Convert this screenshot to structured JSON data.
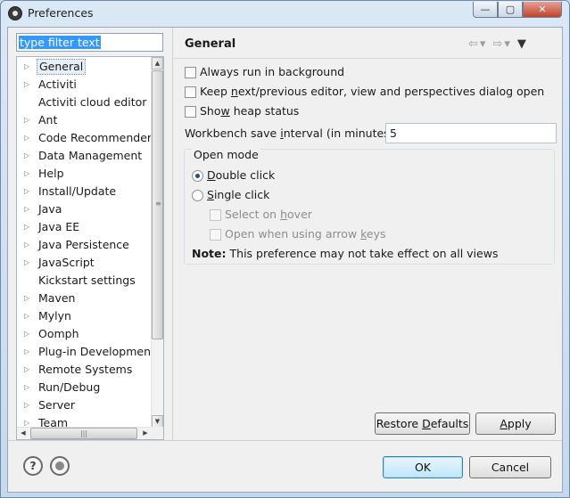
{
  "window": {
    "title": "Preferences",
    "min_glyph": "—",
    "max_glyph": "▢",
    "close_glyph": "✕"
  },
  "filter": {
    "text": "type filter text"
  },
  "tree": {
    "items": [
      {
        "label": "General",
        "expandable": true,
        "selected": true
      },
      {
        "label": "Activiti",
        "expandable": true
      },
      {
        "label": "Activiti cloud editor",
        "expandable": false
      },
      {
        "label": "Ant",
        "expandable": true
      },
      {
        "label": "Code Recommenders",
        "expandable": true
      },
      {
        "label": "Data Management",
        "expandable": true
      },
      {
        "label": "Help",
        "expandable": true
      },
      {
        "label": "Install/Update",
        "expandable": true
      },
      {
        "label": "Java",
        "expandable": true
      },
      {
        "label": "Java EE",
        "expandable": true
      },
      {
        "label": "Java Persistence",
        "expandable": true
      },
      {
        "label": "JavaScript",
        "expandable": true
      },
      {
        "label": "Kickstart settings",
        "expandable": false
      },
      {
        "label": "Maven",
        "expandable": true
      },
      {
        "label": "Mylyn",
        "expandable": true
      },
      {
        "label": "Oomph",
        "expandable": true
      },
      {
        "label": "Plug-in Development",
        "expandable": true
      },
      {
        "label": "Remote Systems",
        "expandable": true
      },
      {
        "label": "Run/Debug",
        "expandable": true
      },
      {
        "label": "Server",
        "expandable": true
      },
      {
        "label": "Team",
        "expandable": true
      }
    ]
  },
  "page": {
    "title": "General",
    "always_run": {
      "pre": "Always run in background",
      "checked": false
    },
    "keep_editor": {
      "pre": "Keep ",
      "mn": "n",
      "post": "ext/previous editor, view and perspectives dialog open",
      "checked": false
    },
    "show_heap": {
      "pre": "Sho",
      "mn": "w",
      "post": " heap status",
      "checked": false
    },
    "interval": {
      "pre": "Workbench save ",
      "mn": "i",
      "post": "nterval (in minutes):",
      "value": "5"
    },
    "open_mode": {
      "legend": "Open mode",
      "double": {
        "pre": "",
        "mn": "D",
        "post": "ouble click",
        "selected": true
      },
      "single": {
        "pre": "",
        "mn": "S",
        "post": "ingle click",
        "selected": false
      },
      "select_hover": {
        "pre": "Select on ",
        "mn": "h",
        "post": "over"
      },
      "arrow_keys": {
        "pre": "Open when using arrow ",
        "mn": "k",
        "post": "eys"
      },
      "note_label": "Note:",
      "note_text": "This preference may not take effect on all views"
    }
  },
  "buttons": {
    "restore": {
      "pre": "Restore ",
      "mn": "D",
      "post": "efaults"
    },
    "apply": {
      "pre": "",
      "mn": "A",
      "post": "pply"
    },
    "ok": "OK",
    "cancel": "Cancel",
    "help_glyph": "?"
  }
}
